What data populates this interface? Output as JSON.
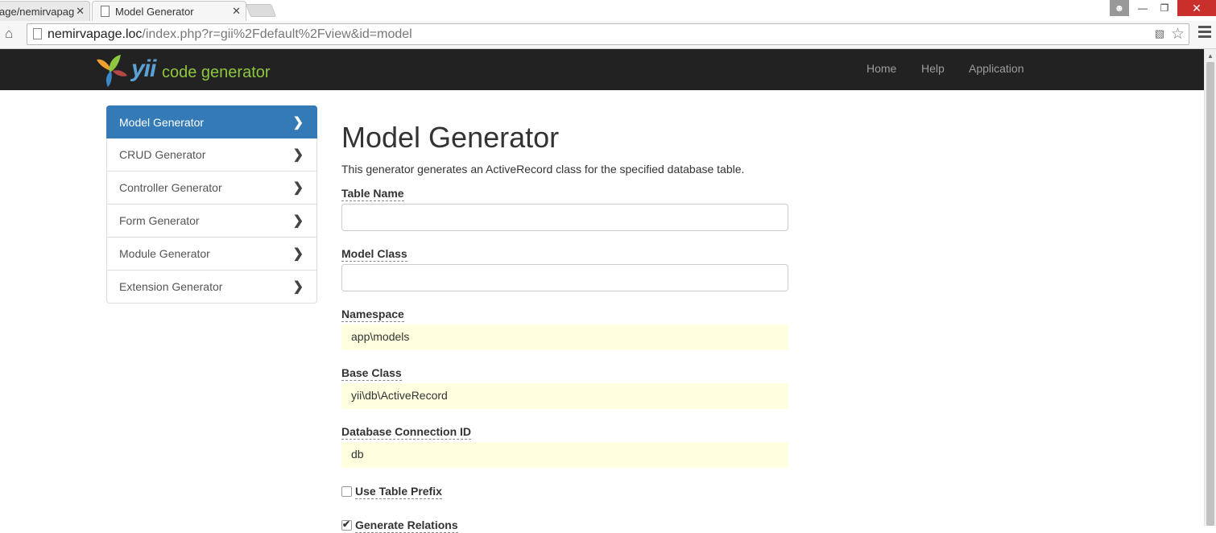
{
  "browser": {
    "tabs": [
      {
        "title": "age/nemirvapag"
      },
      {
        "title": "Model Generator"
      }
    ],
    "url_host": "nemirvapage.loc",
    "url_path": "/index.php?r=gii%2Fdefault%2Fview&id=model"
  },
  "header": {
    "logo_text": "yii",
    "logo_subtext": "code generator",
    "nav": [
      "Home",
      "Help",
      "Application"
    ]
  },
  "sidebar": {
    "items": [
      {
        "label": "Model Generator",
        "active": true
      },
      {
        "label": "CRUD Generator"
      },
      {
        "label": "Controller Generator"
      },
      {
        "label": "Form Generator"
      },
      {
        "label": "Module Generator"
      },
      {
        "label": "Extension Generator"
      }
    ]
  },
  "main": {
    "title": "Model Generator",
    "description": "This generator generates an ActiveRecord class for the specified database table.",
    "fields": {
      "table_name": {
        "label": "Table Name",
        "value": ""
      },
      "model_class": {
        "label": "Model Class",
        "value": ""
      },
      "namespace": {
        "label": "Namespace",
        "value": "app\\models"
      },
      "base_class": {
        "label": "Base Class",
        "value": "yii\\db\\ActiveRecord"
      },
      "db_connection": {
        "label": "Database Connection ID",
        "value": "db"
      },
      "use_table_prefix": {
        "label": "Use Table Prefix",
        "checked": false
      },
      "generate_relations": {
        "label": "Generate Relations",
        "checked": true
      }
    }
  },
  "colors": {
    "navbar_bg": "#222222",
    "active_item": "#337ab7",
    "sticky_bg": "#ffffe0"
  }
}
